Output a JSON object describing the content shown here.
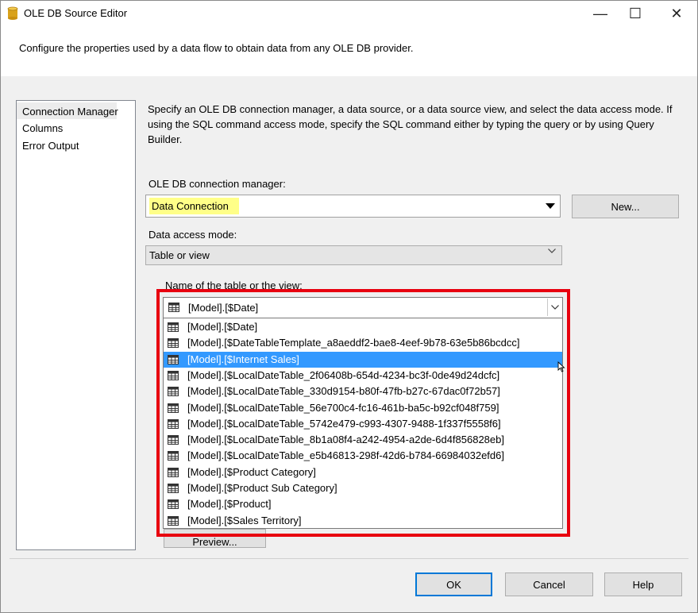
{
  "window": {
    "title": "OLE DB Source Editor",
    "minimize_label": "—",
    "maximize_label": "☐",
    "close_label": "✕"
  },
  "header": {
    "text": "Configure the properties used by a data flow to obtain data from any OLE DB provider."
  },
  "nav": {
    "items": [
      {
        "label": "Connection Manager",
        "selected": true
      },
      {
        "label": "Columns",
        "selected": false
      },
      {
        "label": "Error Output",
        "selected": false
      }
    ]
  },
  "main": {
    "description": "Specify an OLE DB connection manager, a data source, or a data source view, and select the data access mode. If using the SQL command access mode, specify the SQL command either by typing the query or by using Query Builder.",
    "connection_label": "OLE DB connection manager:",
    "connection_value": "Data Connection",
    "new_button": "New...",
    "access_mode_label": "Data access mode:",
    "access_mode_value": "Table or view",
    "table_label": "Name of the table or the view:",
    "table_value": "[Model].[$Date]",
    "table_options": [
      "[Model].[$Date]",
      "[Model].[$DateTableTemplate_a8aeddf2-bae8-4eef-9b78-63e5b86bcdcc]",
      "[Model].[$Internet Sales]",
      "[Model].[$LocalDateTable_2f06408b-654d-4234-bc3f-0de49d24dcfc]",
      "[Model].[$LocalDateTable_330d9154-b80f-47fb-b27c-67dac0f72b57]",
      "[Model].[$LocalDateTable_56e700c4-fc16-461b-ba5c-b92cf048f759]",
      "[Model].[$LocalDateTable_5742e479-c993-4307-9488-1f337f5558f6]",
      "[Model].[$LocalDateTable_8b1a08f4-a242-4954-a2de-6d4f856828eb]",
      "[Model].[$LocalDateTable_e5b46813-298f-42d6-b784-66984032efd6]",
      "[Model].[$Product Category]",
      "[Model].[$Product Sub Category]",
      "[Model].[$Product]",
      "[Model].[$Sales Territory]"
    ],
    "highlighted_option_index": 2,
    "preview_button": "Preview..."
  },
  "footer": {
    "ok": "OK",
    "cancel": "Cancel",
    "help": "Help"
  },
  "colors": {
    "highlight_yellow": "#ffff88",
    "selection_blue": "#3399ff",
    "annotation_red": "#e8000f"
  }
}
